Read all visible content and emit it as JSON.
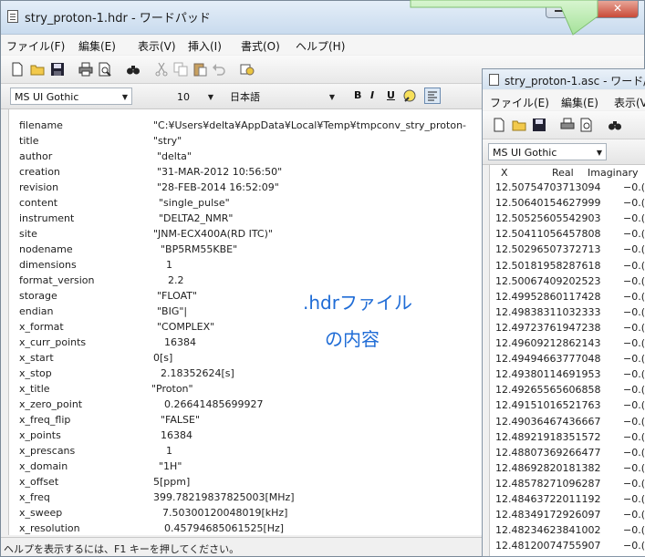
{
  "main_window": {
    "title": "stry_proton-1.hdr - ワードパッド",
    "menu": [
      "ファイル(F)",
      "編集(E)",
      "表示(V)",
      "挿入(I)",
      "書式(O)",
      "ヘルプ(H)"
    ],
    "font_name": "MS UI Gothic",
    "font_size": "10",
    "script": "日本語",
    "format_buttons": [
      "B",
      "I",
      "U"
    ],
    "fields": [
      {
        "key": "filename",
        "value": "\"C:¥Users¥delta¥AppData¥Local¥Temp¥tmpconv_stry_proton-"
      },
      {
        "key": "title",
        "value": "\"stry\""
      },
      {
        "key": "author",
        "value": "\"delta\""
      },
      {
        "key": "creation",
        "value": "\"31-MAR-2012 10:56:50\""
      },
      {
        "key": "revision",
        "value": "\"28-FEB-2014 16:52:09\""
      },
      {
        "key": "content",
        "value": "\"single_pulse\""
      },
      {
        "key": "instrument",
        "value": "\"DELTA2_NMR\""
      },
      {
        "key": "site",
        "value": "\"JNM-ECX400A(RD ITC)\""
      },
      {
        "key": "nodename",
        "value": "\"BP5RM55KBE\""
      },
      {
        "key": "dimensions",
        "value": "1"
      },
      {
        "key": "format_version",
        "value": "2.2"
      },
      {
        "key": "storage",
        "value": "\"FLOAT\""
      },
      {
        "key": "endian",
        "value": "\"BIG\"|"
      },
      {
        "key": "x_format",
        "value": "\"COMPLEX\""
      },
      {
        "key": "x_curr_points",
        "value": "16384"
      },
      {
        "key": "x_start",
        "value": "0[s]"
      },
      {
        "key": "x_stop",
        "value": "2.18352624[s]"
      },
      {
        "key": "x_title",
        "value": "\"Proton\""
      },
      {
        "key": "x_zero_point",
        "value": "0.26641485699927"
      },
      {
        "key": "x_freq_flip",
        "value": "\"FALSE\""
      },
      {
        "key": "x_points",
        "value": "16384"
      },
      {
        "key": "x_prescans",
        "value": "1"
      },
      {
        "key": "x_domain",
        "value": "\"1H\""
      },
      {
        "key": "x_offset",
        "value": "5[ppm]"
      },
      {
        "key": "x_freq",
        "value": "399.78219837825003[MHz]"
      },
      {
        "key": "x_sweep",
        "value": "7.50300120048019[kHz]"
      },
      {
        "key": "x_resolution",
        "value": "0.45794685061525[Hz]"
      }
    ],
    "annotation_line1": ".hdrファイル",
    "annotation_line2": "の内容",
    "status": "ヘルプを表示するには、F1 キーを押してください。"
  },
  "second_window": {
    "title": "stry_proton-1.asc - ワード/",
    "menu": [
      "ファイル(E)",
      "編集(E)",
      "表示(V"
    ],
    "font_name": "MS UI Gothic",
    "col_x": "X",
    "col_real": "Real",
    "col_imag": "Imaginary",
    "rows": [
      "12.50754703713094",
      "12.50640154627999",
      "12.50525605542903",
      "12.50411056457808",
      "12.50296507372713",
      "12.50181958287618",
      "12.50067409202523",
      "12.49952860117428",
      "12.49838311032333",
      "12.49723761947238",
      "12.49609212862143",
      "12.49494663777048",
      "12.49380114691953",
      "12.49265565606858",
      "12.49151016521763",
      "12.49036467436667",
      "12.48921918351572",
      "12.48807369266477",
      "12.48692820181382",
      "12.48578271096287",
      "12.48463722011192",
      "12.48349172926097",
      "12.48234623841002",
      "12.48120074755907"
    ],
    "neg_prefix": "−0.("
  }
}
